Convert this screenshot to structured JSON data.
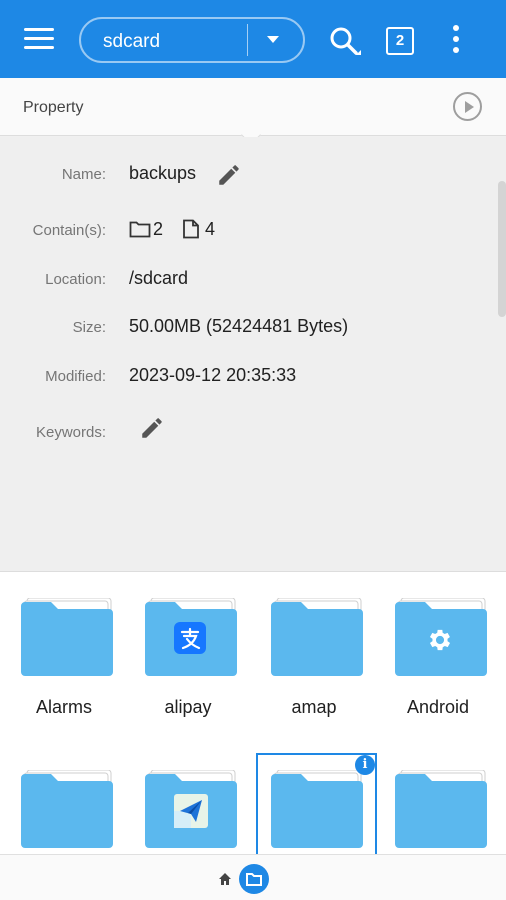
{
  "appbar": {
    "path_label": "sdcard",
    "tab_count": "2",
    "icons": [
      "menu-icon",
      "dropdown-arrow-icon",
      "search-icon",
      "tabs-icon",
      "more-vertical-icon"
    ],
    "background": "#1e88e5"
  },
  "property": {
    "title": "Property",
    "rows": {
      "name_label": "Name:",
      "name_value": "backups",
      "contains_label": "Contain(s):",
      "folder_count": "2",
      "file_count": "4",
      "location_label": "Location:",
      "location_value": "/sdcard",
      "size_label": "Size:",
      "size_value": "50.00MB (52424481 Bytes)",
      "modified_label": "Modified:",
      "modified_value": "2023-09-12 20:35:33",
      "keywords_label": "Keywords:"
    }
  },
  "grid": {
    "items": [
      {
        "label": "Alarms",
        "badge": ""
      },
      {
        "label": "alipay",
        "badge": "alipay-logo-icon"
      },
      {
        "label": "amap",
        "badge": ""
      },
      {
        "label": "Android",
        "badge": "gear-icon"
      },
      {
        "label": "",
        "badge": ""
      },
      {
        "label": "",
        "badge": "send-app-icon"
      },
      {
        "label": "",
        "badge": ""
      },
      {
        "label": "",
        "badge": ""
      }
    ],
    "folder_color": "#5bb8ee"
  },
  "bottombar": {
    "icons": [
      "home-icon",
      "folder-icon"
    ]
  }
}
